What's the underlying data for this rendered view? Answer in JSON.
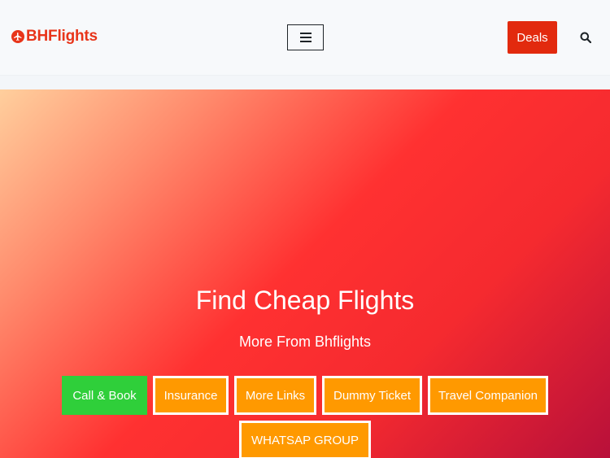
{
  "header": {
    "logo_text": "BHFlights",
    "logo_icon": "plane-icon",
    "menu_icon": "hamburger-icon",
    "deals_label": "Deals",
    "search_icon": "search-icon"
  },
  "hero": {
    "title": "Find Cheap Flights",
    "subtitle": "More From Bhflights",
    "buttons": [
      {
        "label": "Call & Book",
        "color": "#2fcf3a"
      },
      {
        "label": "Insurance",
        "color": "#ff9900"
      },
      {
        "label": "More Links",
        "color": "#ff9900"
      },
      {
        "label": "Dummy Ticket",
        "color": "#ff9900"
      },
      {
        "label": "Travel Companion",
        "color": "#ff9900"
      },
      {
        "label": "WHATSAP GROUP",
        "color": "#ff9900"
      }
    ]
  },
  "colors": {
    "brand": "#e8351a",
    "deals_button": "#e22a0e",
    "gradient_start": "#ffcf9d",
    "gradient_mid": "#ff3131",
    "gradient_end": "#b8103a"
  }
}
